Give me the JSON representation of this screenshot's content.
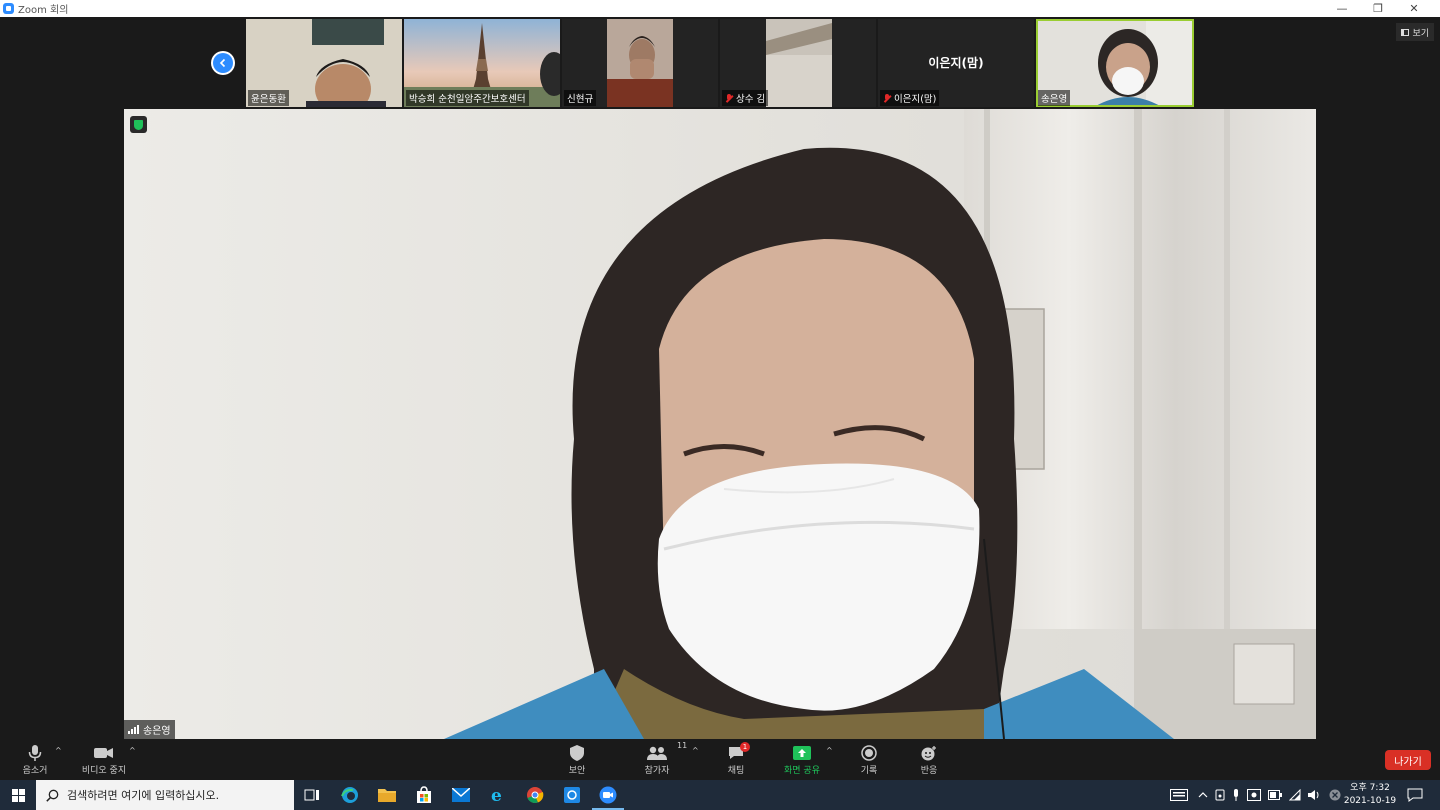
{
  "window": {
    "title": "Zoom 회의",
    "minimize": "—",
    "restore": "❐",
    "close": "✕"
  },
  "view_button": {
    "label": "보기"
  },
  "gallery": [
    {
      "name": "윤은동환"
    },
    {
      "name": "박승희 순천일암주간보호센터"
    },
    {
      "name": "신현규"
    },
    {
      "name": "상수 김",
      "muted": true
    },
    {
      "name": "이은지(맘)",
      "muted": true,
      "display_name": "이은지(맘)"
    },
    {
      "name": "송은영"
    }
  ],
  "main_video": {
    "name": "송은영"
  },
  "toolbar": {
    "mute": "음소거",
    "video": "비디오 중지",
    "security": "보안",
    "participants": "참가자",
    "participants_count": "11",
    "chat": "채팅",
    "chat_badge": "1",
    "share": "화면 공유",
    "record": "기록",
    "reactions": "반응",
    "leave": "나가기"
  },
  "taskbar": {
    "search_placeholder": "검색하려면 여기에 입력하십시오.",
    "time": "오후 7:32",
    "date": "2021-10-19"
  },
  "colors": {
    "zoom_blue": "#2d8cff",
    "leave_red": "#d93025",
    "share_green": "#1fc25a",
    "toolbar_bg": "#1a1a1a",
    "taskbar_bg": "#1f2b3a"
  }
}
